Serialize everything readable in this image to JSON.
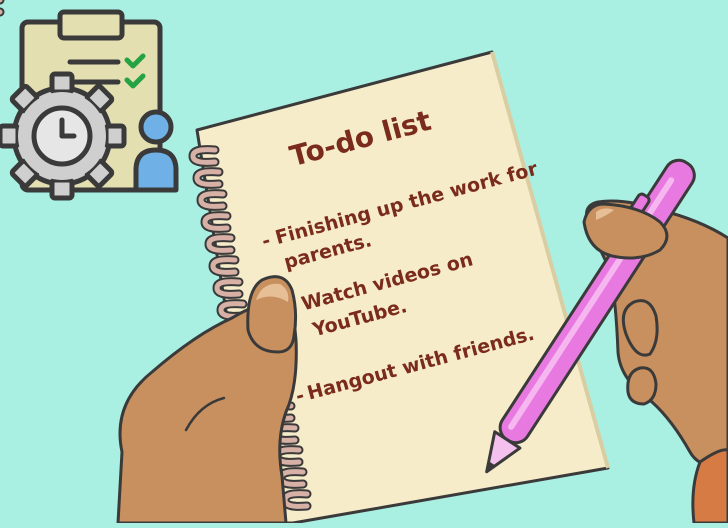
{
  "notepad": {
    "title": "To-do list",
    "items": [
      {
        "bullet": "-",
        "line1": "Finishing up the work for",
        "line2": "parents."
      },
      {
        "bullet": "-",
        "line1": "Watch videos on",
        "line2": "YouTube."
      },
      {
        "bullet": "-",
        "line1": "Hangout with friends.",
        "line2": ""
      }
    ]
  },
  "icons": {
    "top_left": "schedule-checklist-icon",
    "pen": "pink-pen"
  },
  "colors": {
    "background": "#a9efe2",
    "paper": "#f6ecc9",
    "ink": "#7a2b1c",
    "skin": "#c8905f",
    "pen": "#e879e0"
  }
}
